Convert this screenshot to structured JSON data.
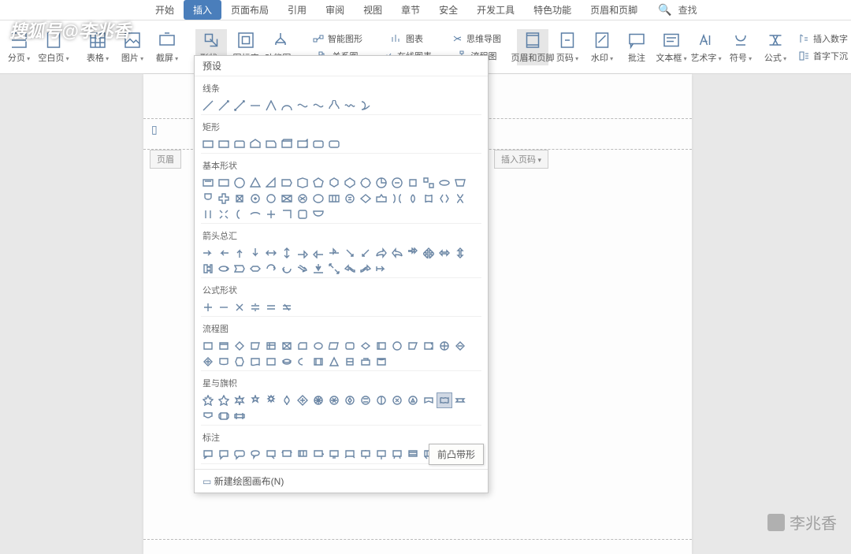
{
  "tabs": {
    "items": [
      "开始",
      "插入",
      "页面布局",
      "引用",
      "审阅",
      "视图",
      "章节",
      "安全",
      "开发工具",
      "特色功能",
      "页眉和页脚"
    ],
    "active_index": 1,
    "search_label": "查找"
  },
  "ribbon": {
    "groups": [
      {
        "icon": "page-break",
        "label": "分页",
        "arrow": true
      },
      {
        "icon": "blank-page",
        "label": "空白页",
        "arrow": true
      },
      {
        "icon": "table",
        "label": "表格",
        "arrow": true
      },
      {
        "icon": "picture",
        "label": "图片",
        "arrow": true
      },
      {
        "icon": "screenshot",
        "label": "截屏",
        "arrow": true
      },
      {
        "icon": "shapes",
        "label": "形状",
        "arrow": true,
        "active": true
      },
      {
        "icon": "icon-lib",
        "label": "图标库"
      },
      {
        "icon": "smartart",
        "label": "功能图",
        "arrow": true
      },
      {
        "icon": "smart-graphic",
        "label": "智能图形",
        "small": true
      },
      {
        "icon": "relation",
        "label": "关系图",
        "small": true
      },
      {
        "icon": "chart",
        "label": "图表",
        "small": true
      },
      {
        "icon": "online-chart",
        "label": "在线图表",
        "small": true
      },
      {
        "icon": "mindmap",
        "label": "思维导图",
        "small": true
      },
      {
        "icon": "flowchart",
        "label": "流程图",
        "small": true
      },
      {
        "icon": "header-footer",
        "label": "页眉和页脚",
        "active": true
      },
      {
        "icon": "page-number",
        "label": "页码",
        "arrow": true
      },
      {
        "icon": "watermark",
        "label": "水印",
        "arrow": true
      },
      {
        "icon": "comment",
        "label": "批注"
      },
      {
        "icon": "textbox",
        "label": "文本框",
        "arrow": true
      },
      {
        "icon": "wordart",
        "label": "艺术字",
        "arrow": true
      },
      {
        "icon": "symbol",
        "label": "符号",
        "arrow": true
      },
      {
        "icon": "equation",
        "label": "公式",
        "arrow": true
      },
      {
        "icon": "insert-number",
        "label": "插入数字",
        "small": true
      },
      {
        "icon": "drop-cap",
        "label": "首字下沉",
        "small": true
      }
    ]
  },
  "page": {
    "header_left_tag": "页眉",
    "header_right_tag": "插入页码"
  },
  "dropdown": {
    "title": "预设",
    "sections": [
      {
        "title": "线条",
        "count": 11
      },
      {
        "title": "矩形",
        "count": 9
      },
      {
        "title": "基本形状",
        "count": 42
      },
      {
        "title": "箭头总汇",
        "count": 29
      },
      {
        "title": "公式形状",
        "count": 6
      },
      {
        "title": "流程图",
        "count": 29
      },
      {
        "title": "星与旗帜",
        "count": 20,
        "selected_index": 15
      },
      {
        "title": "标注",
        "count": 16
      }
    ],
    "footer": "新建绘图画布(N)"
  },
  "tooltip": "前凸带形",
  "watermarks": {
    "top_left": "搜狐号@李兆香",
    "bottom_right": "李兆香"
  }
}
